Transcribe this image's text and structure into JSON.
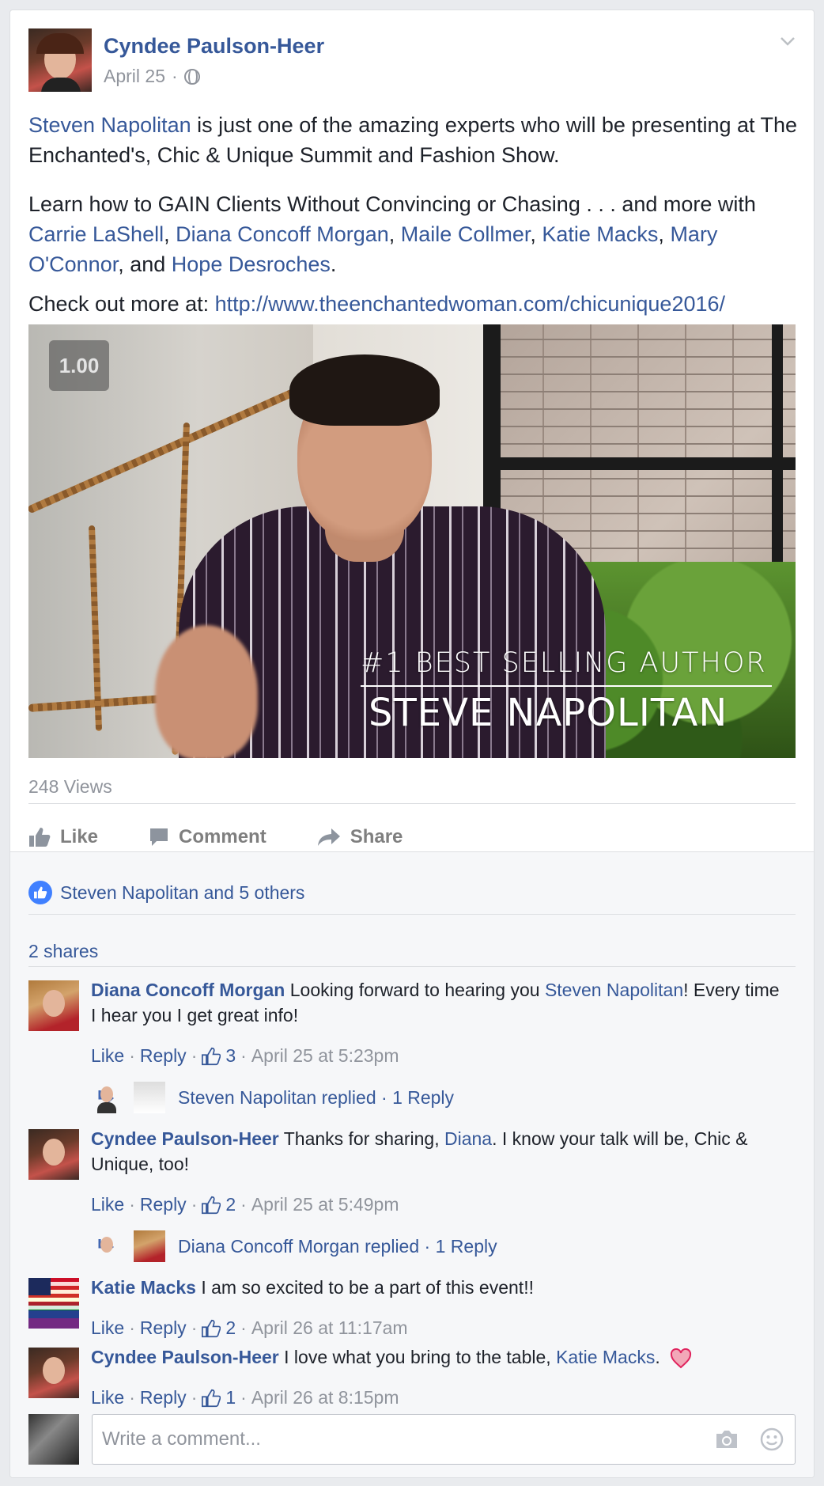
{
  "post": {
    "author": "Cyndee Paulson-Heer",
    "date": "April 25",
    "date_sep": "·",
    "p1": {
      "link": "Steven Napolitan",
      "text": " is just one of the amazing experts who will be presenting at The Enchanted's, Chic & Unique Summit and Fashion Show."
    },
    "p2": {
      "intro": "Learn how to GAIN Clients Without Convincing or Chasing . . . and more with ",
      "n1": "Carrie LaShell",
      "s1": ", ",
      "n2": "Diana Concoff Morgan",
      "s2": ", ",
      "n3": "Maile Collmer",
      "s3": ", ",
      "n4": "Katie Macks",
      "s4": ", ",
      "n5": "Mary O'Connor",
      "s5": ", and ",
      "n6": "Hope Desroches",
      "end": "."
    },
    "p3": {
      "text": "Check out more at: ",
      "url": "http://www.theenchantedwoman.com/chicunique2016/"
    }
  },
  "video": {
    "speed_badge": "1.00",
    "overlay_line1": "#1 BEST SELLING AUTHOR",
    "overlay_line2": "STEVE NAPOLITAN",
    "views": "248 Views"
  },
  "actions": {
    "like": "Like",
    "comment": "Comment",
    "share": "Share"
  },
  "summary": {
    "likes": "Steven Napolitan and 5 others",
    "shares": "2 shares"
  },
  "comments": [
    {
      "name": "Diana Concoff Morgan",
      "t1": " Looking forward to hearing you ",
      "mention": "Steven Napolitan",
      "t2": "! Every time I hear you I get great info!",
      "like": "Like",
      "reply": "Reply",
      "count": "3",
      "time": "April 25 at 5:23pm",
      "replied": "Steven Napolitan replied",
      "reply_count": "1 Reply"
    },
    {
      "name": "Cyndee Paulson-Heer",
      "t1": " Thanks for sharing, ",
      "mention": "Diana",
      "t2": ". I know your talk will be, Chic & Unique, too!",
      "like": "Like",
      "reply": "Reply",
      "count": "2",
      "time": "April 25 at 5:49pm",
      "replied": "Diana Concoff Morgan replied",
      "reply_count": "1 Reply"
    },
    {
      "name": "Katie Macks",
      "t1": " I am so excited to be a part of this event!!",
      "like": "Like",
      "reply": "Reply",
      "count": "2",
      "time": "April 26 at 11:17am"
    },
    {
      "name": "Cyndee Paulson-Heer",
      "t1": " I love what you bring to the table, ",
      "mention": "Katie Macks",
      "t2": ".",
      "like": "Like",
      "reply": "Reply",
      "count": "1",
      "time": "April 26 at 8:15pm"
    }
  ],
  "composer": {
    "placeholder": "Write a comment..."
  },
  "colors": {
    "link": "#365899",
    "meta": "#90949c",
    "like_blue": "#4080ff",
    "heart": "#e0245e"
  }
}
